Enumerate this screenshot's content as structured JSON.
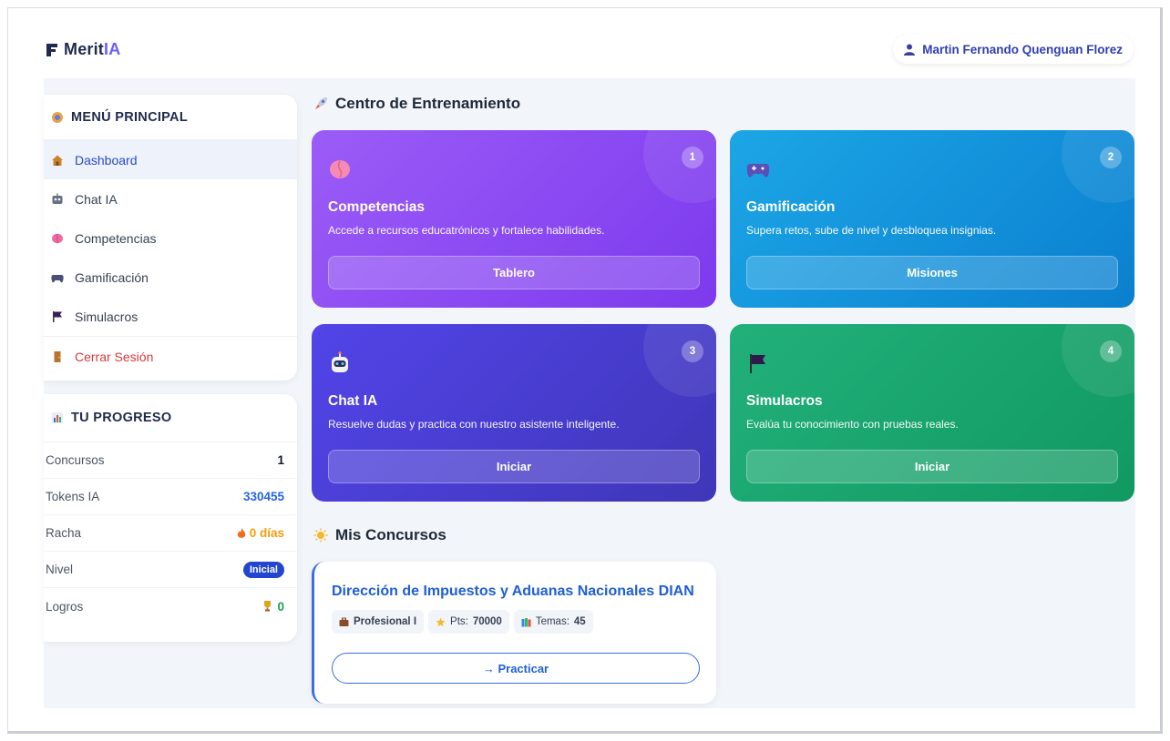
{
  "app": {
    "logo_text_main": "Merit",
    "logo_text_accent": "IA",
    "user_name": "Martin Fernando Quenguan Florez"
  },
  "menu": {
    "title": "MENÚ PRINCIPAL",
    "items": [
      {
        "label": "Dashboard",
        "icon": "house-icon",
        "active": true
      },
      {
        "label": "Chat IA",
        "icon": "robot-icon"
      },
      {
        "label": "Competencias",
        "icon": "brain-icon"
      },
      {
        "label": "Gamificación",
        "icon": "gamepad-icon"
      },
      {
        "label": "Simulacros",
        "icon": "flag-icon"
      }
    ],
    "logout_label": "Cerrar Sesión"
  },
  "progress": {
    "title": "TU PROGRESO",
    "rows": [
      {
        "label": "Concursos",
        "value": "1"
      },
      {
        "label": "Tokens IA",
        "value": "330455"
      },
      {
        "label": "Racha",
        "value": "0 días"
      },
      {
        "label": "Nivel",
        "value": "Inicial"
      },
      {
        "label": "Logros",
        "value": "0"
      }
    ]
  },
  "training": {
    "title": "Centro de Entrenamiento",
    "cards": [
      {
        "num": "1",
        "title": "Competencias",
        "desc": "Accede a recursos educatrónicos y fortalece habilidades.",
        "button": "Tablero",
        "icon": "brain-icon"
      },
      {
        "num": "2",
        "title": "Gamificación",
        "desc": "Supera retos, sube de nivel y desbloquea insignias.",
        "button": "Misiones",
        "icon": "gamepad-icon"
      },
      {
        "num": "3",
        "title": "Chat IA",
        "desc": "Resuelve dudas y practica con nuestro asistente inteligente.",
        "button": "Iniciar",
        "icon": "robot-icon"
      },
      {
        "num": "4",
        "title": "Simulacros",
        "desc": "Evalúa tu conocimiento con pruebas reales.",
        "button": "Iniciar",
        "icon": "flag-icon"
      }
    ]
  },
  "concursos": {
    "title": "Mis Concursos",
    "item": {
      "title": "Dirección de Impuestos y Aduanas Nacionales DIAN",
      "chip_level": "Profesional I",
      "chip_pts_label": "Pts:",
      "chip_pts_value": "70000",
      "chip_temas_label": "Temas:",
      "chip_temas_value": "45",
      "button": "→ Practicar"
    }
  },
  "colors": {
    "accent_blue": "#2949c7",
    "purple_card": "#8b4cf0",
    "blue_card": "#129be0",
    "indigo_card": "#4a3fd6",
    "green_card": "#1aa56f",
    "logout_red": "#d83a3a"
  }
}
